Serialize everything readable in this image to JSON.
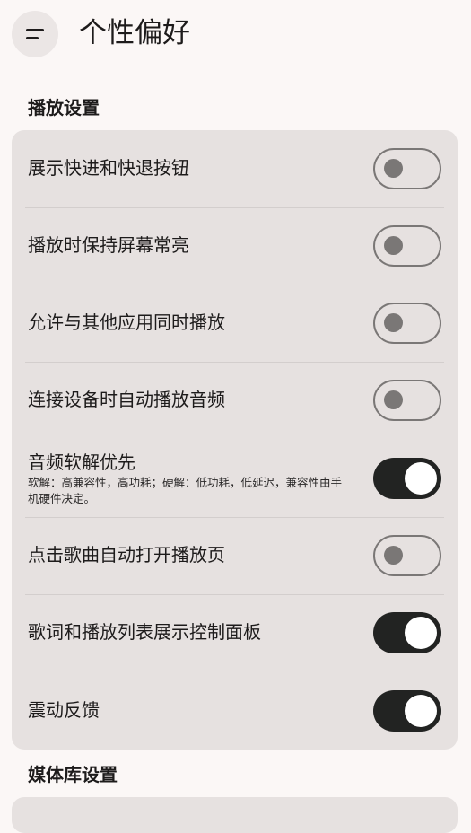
{
  "header": {
    "title": "个性偏好",
    "menu_icon": "menu-icon"
  },
  "playback": {
    "section_title": "播放设置",
    "items": [
      {
        "label": "展示快进和快退按钮",
        "state": "off"
      },
      {
        "label": "播放时保持屏幕常亮",
        "state": "off"
      },
      {
        "label": "允许与其他应用同时播放",
        "state": "off"
      },
      {
        "label": "连接设备时自动播放音频",
        "state": "off"
      },
      {
        "label": "音频软解优先",
        "description": "软解：高兼容性，高功耗；硬解：低功耗，低延迟，兼容性由手机硬件决定。",
        "state": "on"
      },
      {
        "label": "点击歌曲自动打开播放页",
        "state": "off"
      },
      {
        "label": "歌词和播放列表展示控制面板",
        "state": "on"
      },
      {
        "label": "震动反馈",
        "state": "on"
      }
    ]
  },
  "library": {
    "section_title": "媒体库设置"
  },
  "colors": {
    "background": "#fbf7f6",
    "card": "#e6e1e0",
    "switch_on": "#222322",
    "switch_off_outline": "#7a7776"
  }
}
